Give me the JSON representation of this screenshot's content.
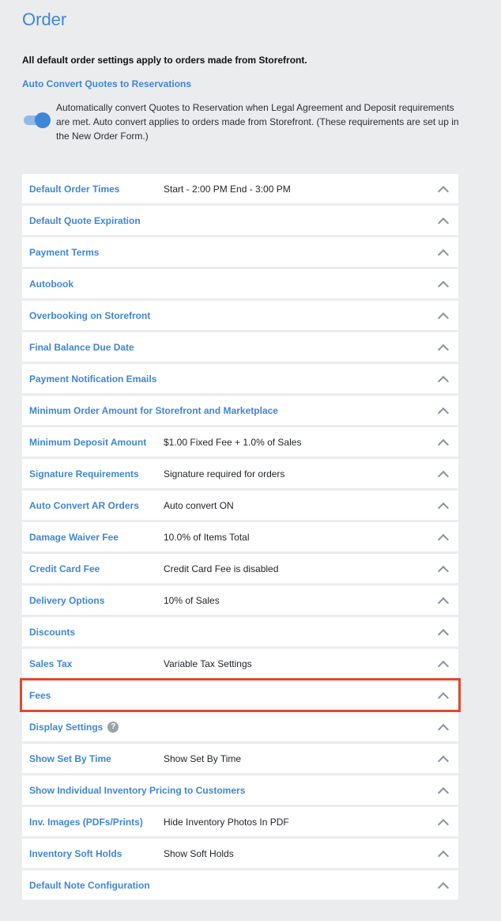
{
  "page": {
    "title": "Order",
    "intro": "All default order settings apply to orders made from Storefront.",
    "auto_convert": {
      "title": "Auto Convert Quotes to Reservations",
      "enabled": true,
      "description": "Automatically convert Quotes to Reservation when Legal Agreement and Deposit requirements are met. Auto convert applies to orders made from Storefront. (These requirements are set up in the New Order Form.)"
    }
  },
  "settings": [
    {
      "label": "Default Order Times",
      "value": "Start - 2:00 PM End - 3:00 PM"
    },
    {
      "label": "Default Quote Expiration",
      "value": ""
    },
    {
      "label": "Payment Terms",
      "value": ""
    },
    {
      "label": "Autobook",
      "value": ""
    },
    {
      "label": "Overbooking on Storefront",
      "value": ""
    },
    {
      "label": "Final Balance Due Date",
      "value": ""
    },
    {
      "label": "Payment Notification Emails",
      "value": ""
    },
    {
      "label": "Minimum Order Amount for Storefront and Marketplace",
      "value": ""
    },
    {
      "label": "Minimum Deposit Amount",
      "value": "$1.00 Fixed Fee + 1.0% of Sales"
    },
    {
      "label": "Signature Requirements",
      "value": "Signature required for orders"
    },
    {
      "label": "Auto Convert AR Orders",
      "value": "Auto convert ON"
    },
    {
      "label": "Damage Waiver Fee",
      "value": "10.0% of Items Total"
    },
    {
      "label": "Credit Card Fee",
      "value": "Credit Card Fee is disabled"
    },
    {
      "label": "Delivery Options",
      "value": "10% of Sales"
    },
    {
      "label": "Discounts",
      "value": ""
    },
    {
      "label": "Sales Tax",
      "value": "Variable Tax Settings"
    },
    {
      "label": "Fees",
      "value": ""
    },
    {
      "label": "Display Settings",
      "value": "",
      "help_icon": "?"
    },
    {
      "label": "Show Set By Time",
      "value": "Show Set By Time"
    },
    {
      "label": "Show Individual Inventory Pricing to Customers",
      "value": ""
    },
    {
      "label": "Inv. Images (PDFs/Prints)",
      "value": "Hide Inventory Photos In PDF"
    },
    {
      "label": "Inventory Soft Holds",
      "value": "Show Soft Holds"
    },
    {
      "label": "Default Note Configuration",
      "value": ""
    }
  ],
  "highlighted_setting": "Fees",
  "colors": {
    "accent": "#3f86d6",
    "highlight": "#e0492f",
    "background": "#ebeced"
  },
  "icons": {
    "toggle": "toggle-switch-on",
    "expand": "chevron-up-icon",
    "help": "question-circle-icon"
  }
}
